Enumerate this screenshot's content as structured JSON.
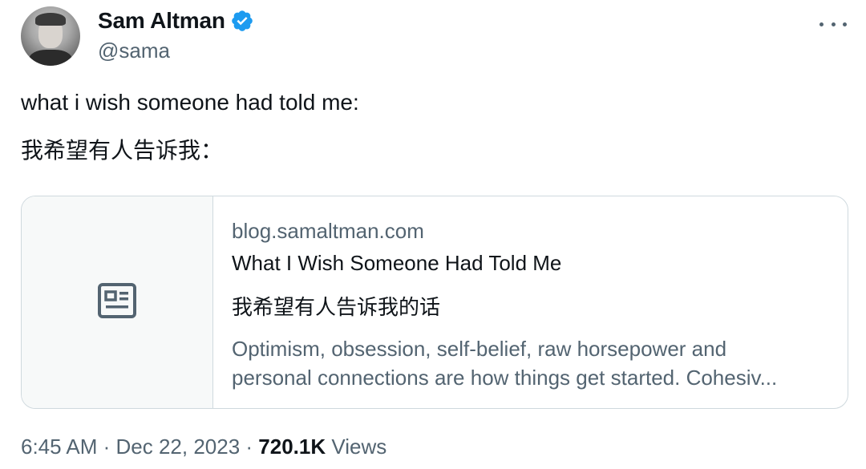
{
  "author": {
    "display_name": "Sam Altman",
    "handle": "@sama",
    "verified": true
  },
  "icons": {
    "verified": "verified-badge-icon",
    "more": "more-options-icon",
    "article": "article-icon"
  },
  "colors": {
    "verified_blue": "#1d9bf0",
    "secondary_text": "#536471",
    "border": "#cfd9de"
  },
  "tweet": {
    "text_line1": "what i wish someone had told me:",
    "text_line2": "我希望有人告诉我："
  },
  "card": {
    "domain": "blog.samaltman.com",
    "title": "What I Wish Someone Had Told Me",
    "subtitle": "我希望有人告诉我的话",
    "description_line1": "Optimism, obsession, self-belief, raw horsepower and",
    "description_line2": "personal connections are how things get started. Cohesiv..."
  },
  "meta": {
    "time": "6:45 AM",
    "separator1": " · ",
    "date": "Dec 22, 2023",
    "separator2": " · ",
    "views_count": "720.1K",
    "views_label": " Views"
  }
}
